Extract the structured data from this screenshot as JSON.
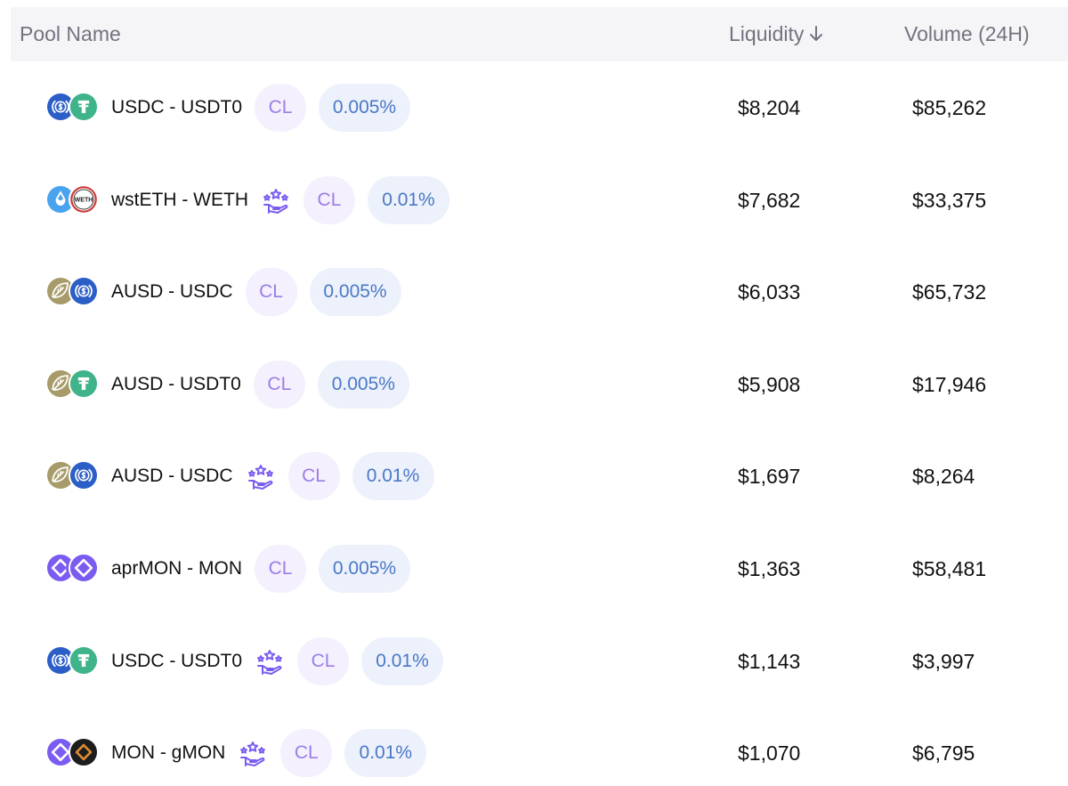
{
  "header": {
    "pool_name": "Pool Name",
    "liquidity": "Liquidity",
    "volume": "Volume (24H)",
    "sort_icon": "arrow-down-icon"
  },
  "colors": {
    "usdc": "#2b5ec7",
    "usdt0": "#3fb389",
    "ausd": "#a89b6a",
    "mon": "#7b5cf0",
    "gmon": "#e08b33",
    "wsteth": "#4aa3ee",
    "weth": "#d03a3a",
    "cl_pill_bg": "#f4f0fd",
    "cl_pill_text": "#9b7ee6",
    "fee_pill_bg": "#edf1fb",
    "fee_pill_text": "#4a78c6"
  },
  "rows": [
    {
      "name": "USDC - USDT0",
      "token_icons": [
        "usdc-icon",
        "usdt0-icon"
      ],
      "reward": false,
      "type": "CL",
      "fee": "0.005%",
      "liquidity": "$8,204",
      "volume": "$85,262"
    },
    {
      "name": "wstETH - WETH",
      "token_icons": [
        "wsteth-icon",
        "weth-icon"
      ],
      "reward": true,
      "type": "CL",
      "fee": "0.01%",
      "liquidity": "$7,682",
      "volume": "$33,375"
    },
    {
      "name": "AUSD - USDC",
      "token_icons": [
        "ausd-icon",
        "usdc-icon"
      ],
      "reward": false,
      "type": "CL",
      "fee": "0.005%",
      "liquidity": "$6,033",
      "volume": "$65,732"
    },
    {
      "name": "AUSD - USDT0",
      "token_icons": [
        "ausd-icon",
        "usdt0-icon"
      ],
      "reward": false,
      "type": "CL",
      "fee": "0.005%",
      "liquidity": "$5,908",
      "volume": "$17,946"
    },
    {
      "name": "AUSD - USDC",
      "token_icons": [
        "ausd-icon",
        "usdc-icon"
      ],
      "reward": true,
      "type": "CL",
      "fee": "0.01%",
      "liquidity": "$1,697",
      "volume": "$8,264"
    },
    {
      "name": "aprMON - MON",
      "token_icons": [
        "aprmon-icon",
        "mon-icon"
      ],
      "reward": false,
      "type": "CL",
      "fee": "0.005%",
      "liquidity": "$1,363",
      "volume": "$58,481"
    },
    {
      "name": "USDC - USDT0",
      "token_icons": [
        "usdc-icon",
        "usdt0-icon"
      ],
      "reward": true,
      "type": "CL",
      "fee": "0.01%",
      "liquidity": "$1,143",
      "volume": "$3,997"
    },
    {
      "name": "MON - gMON",
      "token_icons": [
        "mon-icon",
        "gmon-icon"
      ],
      "reward": true,
      "type": "CL",
      "fee": "0.01%",
      "liquidity": "$1,070",
      "volume": "$6,795"
    }
  ]
}
